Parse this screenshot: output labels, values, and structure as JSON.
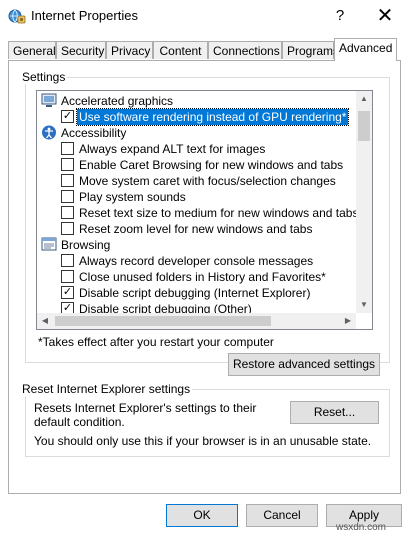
{
  "window": {
    "title": "Internet Properties",
    "help_glyph": "?",
    "close_glyph": "✕"
  },
  "tabs": [
    {
      "label": "General"
    },
    {
      "label": "Security"
    },
    {
      "label": "Privacy"
    },
    {
      "label": "Content"
    },
    {
      "label": "Connections"
    },
    {
      "label": "Programs"
    },
    {
      "label": "Advanced",
      "active": true
    }
  ],
  "settings": {
    "group_label": "Settings",
    "items": [
      {
        "type": "category",
        "icon": "monitor-icon",
        "label": "Accelerated graphics"
      },
      {
        "type": "checkbox",
        "checked": true,
        "selected": true,
        "label": "Use software rendering instead of GPU rendering*"
      },
      {
        "type": "category",
        "icon": "accessibility-icon",
        "label": "Accessibility"
      },
      {
        "type": "checkbox",
        "checked": false,
        "label": "Always expand ALT text for images"
      },
      {
        "type": "checkbox",
        "checked": false,
        "label": "Enable Caret Browsing for new windows and tabs"
      },
      {
        "type": "checkbox",
        "checked": false,
        "label": "Move system caret with focus/selection changes"
      },
      {
        "type": "checkbox",
        "checked": false,
        "label": "Play system sounds"
      },
      {
        "type": "checkbox",
        "checked": false,
        "label": "Reset text size to medium for new windows and tabs"
      },
      {
        "type": "checkbox",
        "checked": false,
        "label": "Reset zoom level for new windows and tabs"
      },
      {
        "type": "category",
        "icon": "browsing-icon",
        "label": "Browsing"
      },
      {
        "type": "checkbox",
        "checked": false,
        "label": "Always record developer console messages"
      },
      {
        "type": "checkbox",
        "checked": false,
        "label": "Close unused folders in History and Favorites*"
      },
      {
        "type": "checkbox",
        "checked": true,
        "label": "Disable script debugging (Internet Explorer)"
      },
      {
        "type": "checkbox",
        "checked": true,
        "label": "Disable script debugging (Other)"
      }
    ],
    "note": "*Takes effect after you restart your computer",
    "restore_button": "Restore advanced settings"
  },
  "reset": {
    "group_label": "Reset Internet Explorer settings",
    "description": "Resets Internet Explorer's settings to their default condition.",
    "button": "Reset...",
    "warning": "You should only use this if your browser is in an unusable state."
  },
  "footer": {
    "ok": "OK",
    "cancel": "Cancel",
    "apply": "Apply"
  },
  "watermark": "wsxdn.com"
}
